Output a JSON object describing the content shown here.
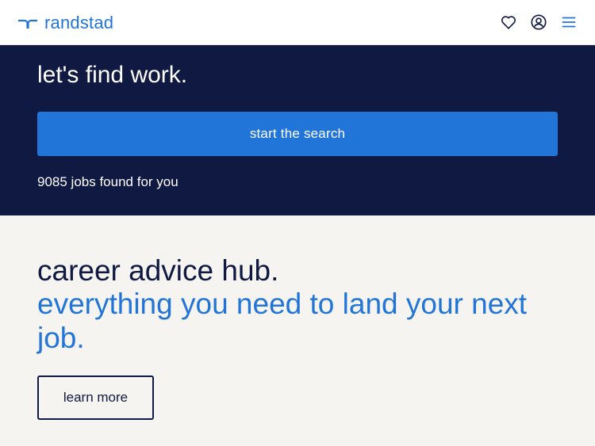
{
  "header": {
    "logo_text": "randstad",
    "icons": [
      "heart-icon",
      "account-icon",
      "menu-icon"
    ]
  },
  "hero": {
    "title": "let's find work.",
    "search_button_label": "start the search",
    "jobs_found": "9085 jobs found for you"
  },
  "advice": {
    "title": "career advice hub.",
    "subtitle": "everything you need to land your next job.",
    "button_label": "learn more"
  },
  "colors": {
    "brand_blue": "#2175d9",
    "navy": "#0f1941",
    "cream_background": "#f5f4f0",
    "white": "#ffffff"
  }
}
